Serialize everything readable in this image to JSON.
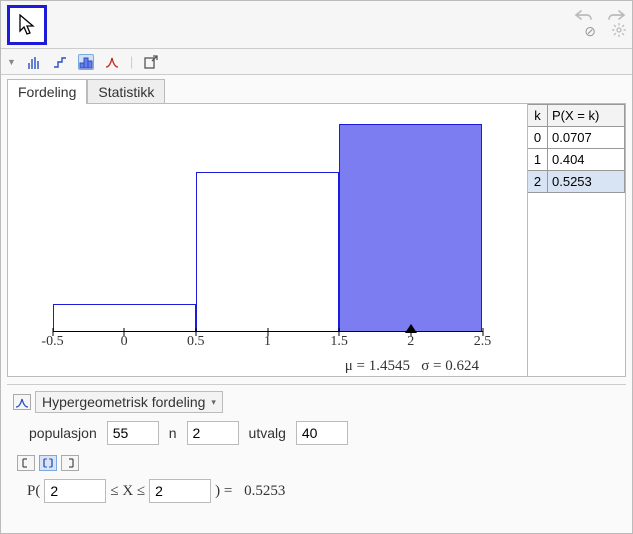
{
  "chart_data": {
    "type": "bar",
    "categories": [
      0,
      1,
      2
    ],
    "values": [
      0.0707,
      0.404,
      0.5253
    ],
    "highlight_range": [
      2,
      2
    ],
    "xlabel": "",
    "ylabel": "",
    "x_ticks": [
      -0.5,
      0,
      0.5,
      1,
      1.5,
      2,
      2.5
    ],
    "marker_x": 2,
    "title": ""
  },
  "tabs": [
    {
      "label": "Fordeling",
      "active": true
    },
    {
      "label": "Statistikk",
      "active": false
    }
  ],
  "ticks": {
    "t0": "-0.5",
    "t1": "0",
    "t2": "0.5",
    "t3": "1",
    "t4": "1.5",
    "t5": "2",
    "t6": "2.5"
  },
  "stats": {
    "mu_label": "μ =",
    "mu_value": "1.4545",
    "sigma_label": "σ =",
    "sigma_value": "0.624"
  },
  "table": {
    "head_k": "k",
    "head_p": "P(X = k)",
    "rows": [
      {
        "k": "0",
        "p": "0.0707",
        "selected": false
      },
      {
        "k": "1",
        "p": "0.404",
        "selected": false
      },
      {
        "k": "2",
        "p": "0.5253",
        "selected": true
      }
    ]
  },
  "distribution": {
    "name": "Hypergeometrisk fordeling",
    "params": {
      "pop_label": "populasjon",
      "pop_value": "55",
      "n_label": "n",
      "n_value": "2",
      "sample_label": "utvalg",
      "sample_value": "40"
    }
  },
  "probability": {
    "prefix": "P(",
    "low": "2",
    "mid": "≤ X ≤",
    "high": "2",
    "suffix": ") =",
    "result": "0.5253"
  }
}
